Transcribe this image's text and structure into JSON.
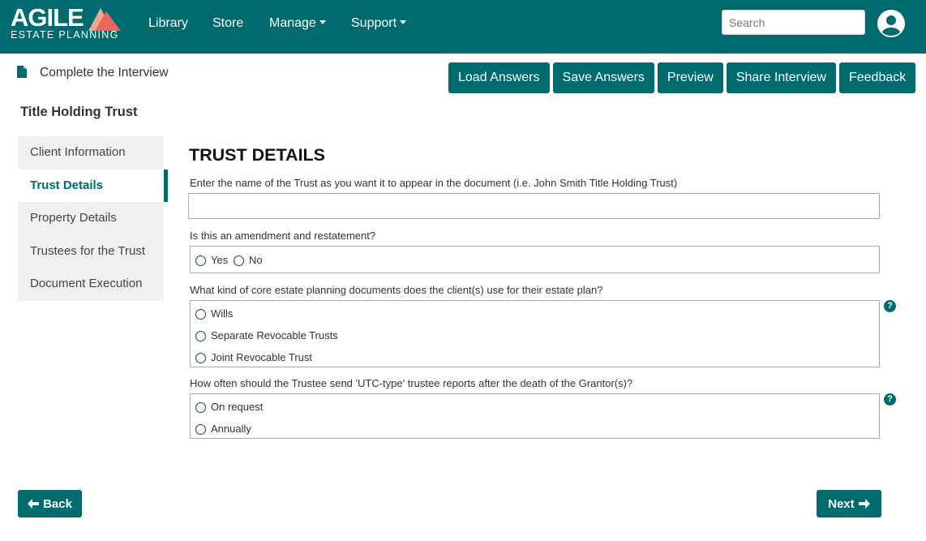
{
  "brand": {
    "name": "AGILE",
    "tagline": "ESTATE PLANNING",
    "accent_color": "#e8665a",
    "primary_color": "#006b6f"
  },
  "nav": {
    "items": [
      {
        "label": "Library",
        "dropdown": false
      },
      {
        "label": "Store",
        "dropdown": false
      },
      {
        "label": "Manage",
        "dropdown": true
      },
      {
        "label": "Support",
        "dropdown": true
      }
    ],
    "search": {
      "placeholder": "Search",
      "value": ""
    },
    "avatar_icon": "user-circle-icon"
  },
  "header": {
    "interview_title": "Complete the Interview",
    "interview_icon": "document-icon",
    "actions": [
      "Load Answers",
      "Save Answers",
      "Preview",
      "Share Interview",
      "Feedback"
    ],
    "page_title": "Title Holding Trust"
  },
  "sidebar": {
    "items": [
      {
        "label": "Client Information",
        "active": false
      },
      {
        "label": "Trust Details",
        "active": true
      },
      {
        "label": "Property Details",
        "active": false
      },
      {
        "label": "Trustees for the Trust",
        "active": false
      },
      {
        "label": "Document Execution",
        "active": false
      }
    ]
  },
  "form": {
    "section_title": "TRUST DETAILS",
    "questions": [
      {
        "label": "Enter the name of the Trust as you want it to appear in the document (i.e. John Smith Title Holding Trust)",
        "type": "text",
        "value": ""
      },
      {
        "label": "Is this an amendment and restatement?",
        "type": "radio",
        "options": [
          "Yes",
          "No"
        ],
        "selected": null
      },
      {
        "label": "What kind of core estate planning documents does the client(s) use for their estate plan?",
        "type": "radio",
        "options": [
          "Wills",
          "Separate Revocable Trusts",
          "Joint Revocable Trust"
        ],
        "selected": null,
        "help_icon": "question-circle-icon"
      },
      {
        "label": "How often should the Trustee send 'UTC-type' trustee reports after the death of the Grantor(s)?",
        "type": "radio",
        "options": [
          "On request",
          "Annually"
        ],
        "selected": null,
        "help_icon": "question-circle-icon"
      }
    ]
  },
  "footer": {
    "back_label": "Back",
    "next_label": "Next"
  }
}
